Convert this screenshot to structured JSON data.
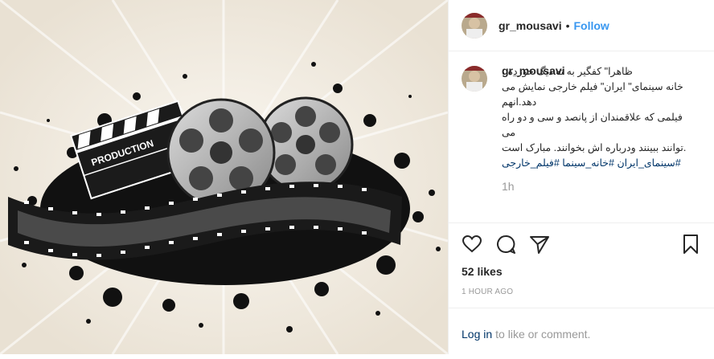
{
  "media": {
    "slate_text": "PRODUCTION",
    "background_color": "#f1ebe1"
  },
  "header": {
    "username": "gr_mousavi",
    "separator": "•",
    "follow_label": "Follow"
  },
  "comment": {
    "username": "gr_mousavi",
    "caption_lines": [
      "ظاهرا\" کفگیر به ته دیگ خورده ، ",
      "خانه سینمای\" ایران\" فیلم خارجی نمایش می دهد.انهم",
      "فیلمی که علاقمندان از پانصد و سی و دو راه می",
      ".توانند ببینند ودرباره اش بخوانند. مبارک است"
    ],
    "hashtags": "#سینمای_ایران #خانه_سینما #فیلم_خارجی",
    "relative_time": "1h"
  },
  "actions": {
    "like_icon": "heart-icon",
    "comment_icon": "comment-icon",
    "share_icon": "paper-plane-icon",
    "save_icon": "bookmark-icon"
  },
  "likes_text": "52 likes",
  "timestamp": "1 HOUR AGO",
  "login": {
    "link": "Log in",
    "rest": "to like or comment."
  },
  "colors": {
    "accent": "#3897f0",
    "link": "#003569",
    "muted": "#999999",
    "text": "#262626"
  }
}
